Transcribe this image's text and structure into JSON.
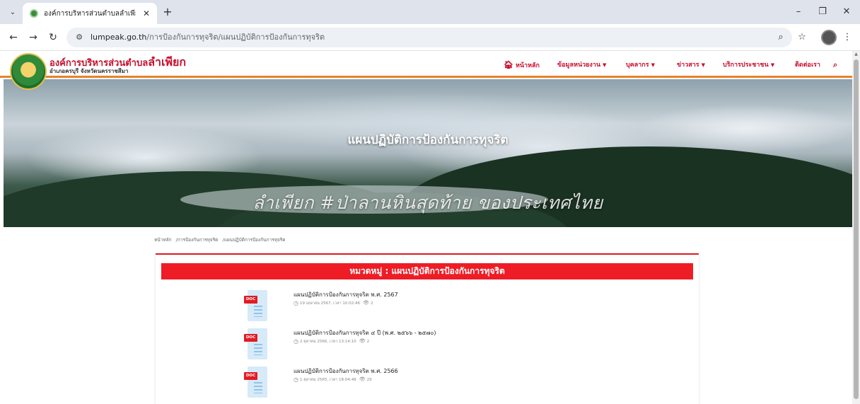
{
  "browser": {
    "tab_title": "องค์การบริหารส่วนตำบลลำเพียก - อ",
    "tab_close": "✕",
    "new_tab": "+",
    "url_host": "lumpeak.go.th",
    "url_path": "/การป้องกันการทุจริต/แผนปฏิบัติการป้องกันการทุจริต",
    "icons": [
      "tab-dropdown-icon",
      "back-icon",
      "forward-icon",
      "reload-icon",
      "site-info-icon",
      "zoom-icon",
      "bookmark-star-icon",
      "menu-icon",
      "minimize-icon",
      "restore-icon",
      "close-icon"
    ]
  },
  "site": {
    "brand_prefix": "องค์การบริหารส่วนตำบล",
    "brand_name": "ลำเพียก",
    "brand_sub": "อำเภอครบุรี จังหวัดนครราชสีมา",
    "nav": [
      {
        "label": "หน้าหลัก",
        "icon": "home-icon"
      },
      {
        "label": "ข้อมูลหน่วยงาน",
        "dropdown": true
      },
      {
        "label": "บุคลากร",
        "dropdown": true
      },
      {
        "label": "ข่าวสาร",
        "dropdown": true
      },
      {
        "label": "บริการประชาชน",
        "dropdown": true
      },
      {
        "label": "ติดต่อเรา"
      }
    ],
    "search_icon": "search-icon",
    "accent_color": "#c8102e",
    "header_line_color": "#e8822a"
  },
  "hero": {
    "title": "แผนปฏิบัติการป้องกันการทุจริต",
    "slogan": "ลำเพียก #ป่าลานหินสุดท้าย ของประเทศไทย"
  },
  "breadcrumb": [
    "หน้าหลัก",
    "/การป้องกันการทุจริต",
    "/แผนปฏิบัติการป้องกันการทุจริต"
  ],
  "category": {
    "banner": "หมวดหมู่ : แผนปฏิบัติการป้องกันการทุจริต",
    "banner_color": "#ee1c25"
  },
  "documents": [
    {
      "badge": "DOC",
      "title": "แผนปฏิบัติการป้องกันการทุจริต พ.ศ. 2567",
      "date": "19 เมษายน 2567, เวลา 10:02:46",
      "views": "2"
    },
    {
      "badge": "DOC",
      "title": "แผนปฏิบัติการป้องกันการทุจริต ๔ ปี (พ.ศ. ๒๕๖๖ - ๒๕๗๐)",
      "date": "2 ตุลาคม 2566, เวลา 13:14:10",
      "views": "2"
    },
    {
      "badge": "DOC",
      "title": "แผนปฏิบัติการป้องกันการทุจริต พ.ศ. 2566",
      "date": "1 ตุลาคม 2565, เวลา 18:04:48",
      "views": "29"
    }
  ]
}
